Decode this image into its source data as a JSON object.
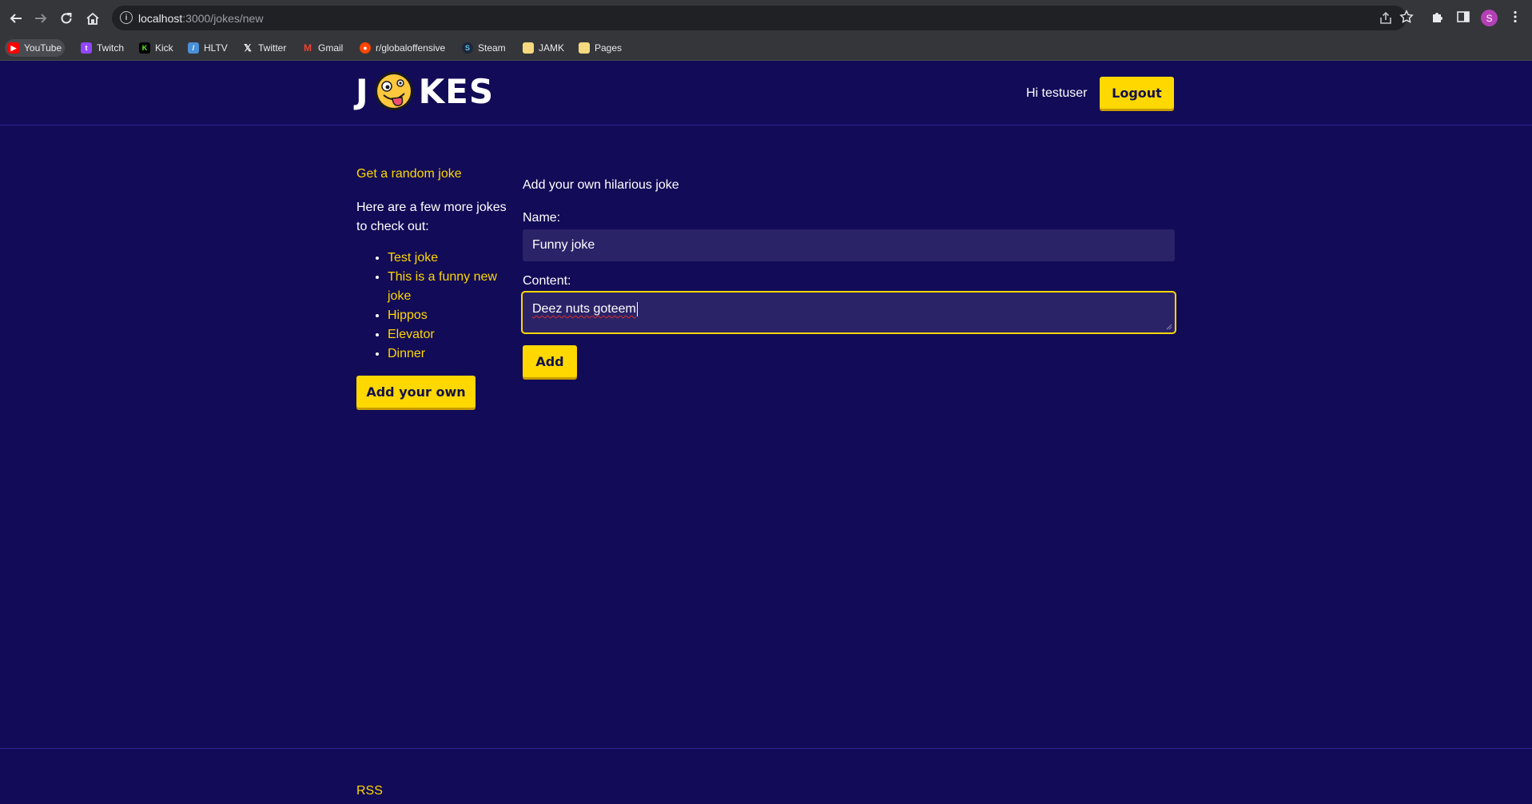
{
  "browser": {
    "url_host": "localhost",
    "url_path": ":3000/jokes/new",
    "profile_initial": "S",
    "bookmarks": [
      {
        "label": "YouTube",
        "icon": "youtube-icon",
        "color": "#ff0000"
      },
      {
        "label": "Twitch",
        "icon": "twitch-icon",
        "color": "#9146ff"
      },
      {
        "label": "Kick",
        "icon": "kick-icon",
        "color": "#53fc18"
      },
      {
        "label": "HLTV",
        "icon": "hltv-icon",
        "color": "#4a90d9"
      },
      {
        "label": "Twitter",
        "icon": "x-icon",
        "color": "#ffffff"
      },
      {
        "label": "Gmail",
        "icon": "gmail-icon",
        "color": "#ea4335"
      },
      {
        "label": "r/globaloffensive",
        "icon": "reddit-icon",
        "color": "#ff4500"
      },
      {
        "label": "Steam",
        "icon": "steam-icon",
        "color": "#66c0f4"
      },
      {
        "label": "JAMK",
        "icon": "folder-icon",
        "color": "#f5d97e"
      },
      {
        "label": "Pages",
        "icon": "folder-icon",
        "color": "#f5d97e"
      }
    ]
  },
  "header": {
    "logo_left": "J",
    "logo_right": "KES",
    "greeting": "Hi testuser",
    "logout_label": "Logout"
  },
  "sidebar": {
    "random_link": "Get a random joke",
    "intro": "Here are a few more jokes to check out:",
    "jokes": [
      "Test joke",
      "This is a funny new joke",
      "Hippos",
      "Elevator",
      "Dinner"
    ],
    "add_own_label": "Add your own"
  },
  "form": {
    "title": "Add your own hilarious joke",
    "name_label": "Name:",
    "name_value": "Funny joke",
    "content_label": "Content:",
    "content_value": "Deez nuts goteem",
    "submit_label": "Add"
  },
  "footer": {
    "rss_label": "RSS"
  },
  "colors": {
    "background": "#120b57",
    "accent": "#ffd800",
    "input_bg": "#2b2368"
  }
}
